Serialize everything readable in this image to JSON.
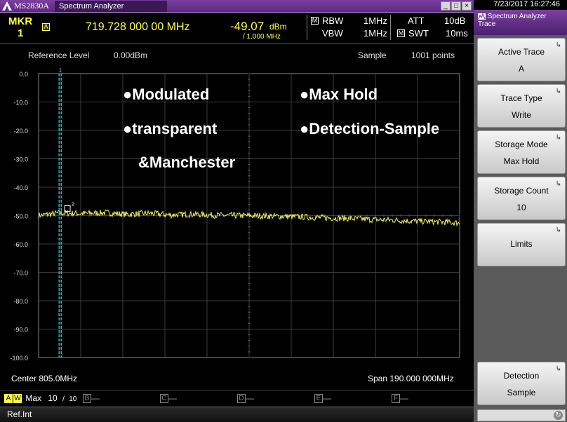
{
  "titlebar": {
    "model": "MS2830A",
    "app": "Spectrum Analyzer",
    "btn_min": "_",
    "btn_max": "□",
    "btn_close": "×"
  },
  "marker": {
    "label": "MKR",
    "number": "1",
    "icon": "A",
    "frequency": "719.728 000 00 MHz",
    "level": "-49.07",
    "level_unit": "dBm",
    "bandwidth_note": "/ 1.000 MHz"
  },
  "settings": {
    "rbw_label": "RBW",
    "rbw_icon": "M",
    "rbw": "1MHz",
    "vbw_label": "VBW",
    "vbw": "1MHz",
    "att_label": "ATT",
    "att": "10dB",
    "swt_label": "SWT",
    "swt_icon": "M",
    "swt": "10ms"
  },
  "graph": {
    "reference_level_label": "Reference Level",
    "reference_level": "0.00dBm",
    "detection": "Sample",
    "points": "1001 points",
    "center": "Center 805.0MHz",
    "span": "Span 190.000 000MHz",
    "marker_tag": "1",
    "marker2_tag": "2",
    "y_ticks": [
      "0.0",
      "-10.0",
      "-20.0",
      "-30.0",
      "-40.0",
      "-50.0",
      "-60.0",
      "-70.0",
      "-80.0",
      "-90.0",
      "-100.0"
    ]
  },
  "annotations": {
    "line1": "●Modulated",
    "line2": "●transparent",
    "line3": "&Manchester",
    "line4": "●Max Hold",
    "line5": "●Detection-Sample"
  },
  "chart_data": {
    "type": "line",
    "title": "",
    "xlabel": "",
    "ylabel": "",
    "x_range_mhz": [
      710.0,
      900.0
    ],
    "ylim": [
      -100,
      0
    ],
    "grid": true,
    "series": [
      {
        "x": [
          710,
          719.7,
          730,
          740,
          750,
          760,
          770,
          780,
          790,
          800,
          810,
          820,
          830,
          840,
          850,
          860,
          870,
          880,
          890,
          900
        ],
        "values": [
          -50.0,
          -49.1,
          -49.3,
          -49.0,
          -49.6,
          -49.2,
          -49.8,
          -49.5,
          -49.9,
          -50.0,
          -50.1,
          -50.3,
          -50.5,
          -50.8,
          -51.0,
          -51.4,
          -51.6,
          -52.0,
          -52.2,
          -52.6
        ]
      }
    ],
    "markers": [
      {
        "label": "1",
        "x": 719.728,
        "y": -49.07
      },
      {
        "label": "2",
        "x": 723.0,
        "y": -49.0
      }
    ]
  },
  "tracebar": {
    "trace_a": "A",
    "trace_a_mode": "W",
    "trace_a_label": "Max",
    "count": "10",
    "count_sep": "/",
    "count_total": "10",
    "trace_b": "B",
    "trace_c": "C",
    "trace_d": "D",
    "trace_e": "E",
    "trace_f": "F",
    "dash": "—",
    "ref": "Ref.Int"
  },
  "panel": {
    "clock": "7/23/2017 16:27:46",
    "title": "Spectrum Analyzer",
    "subtitle": "Trace",
    "softkeys": [
      {
        "label": "Active Trace",
        "value": "A"
      },
      {
        "label": "Trace Type",
        "value": "Write"
      },
      {
        "label": "Storage Mode",
        "value": "Max Hold"
      },
      {
        "label": "Storage Count",
        "value": "10"
      },
      {
        "label": "Limits",
        "value": ""
      },
      {
        "label": "Detection",
        "value": "Sample"
      }
    ]
  },
  "colors": {
    "trace": "#f0f060",
    "marker_line": "#20d8e8",
    "accent_purple": "#7b3fa0",
    "marker_yellow": "#ffff40"
  }
}
